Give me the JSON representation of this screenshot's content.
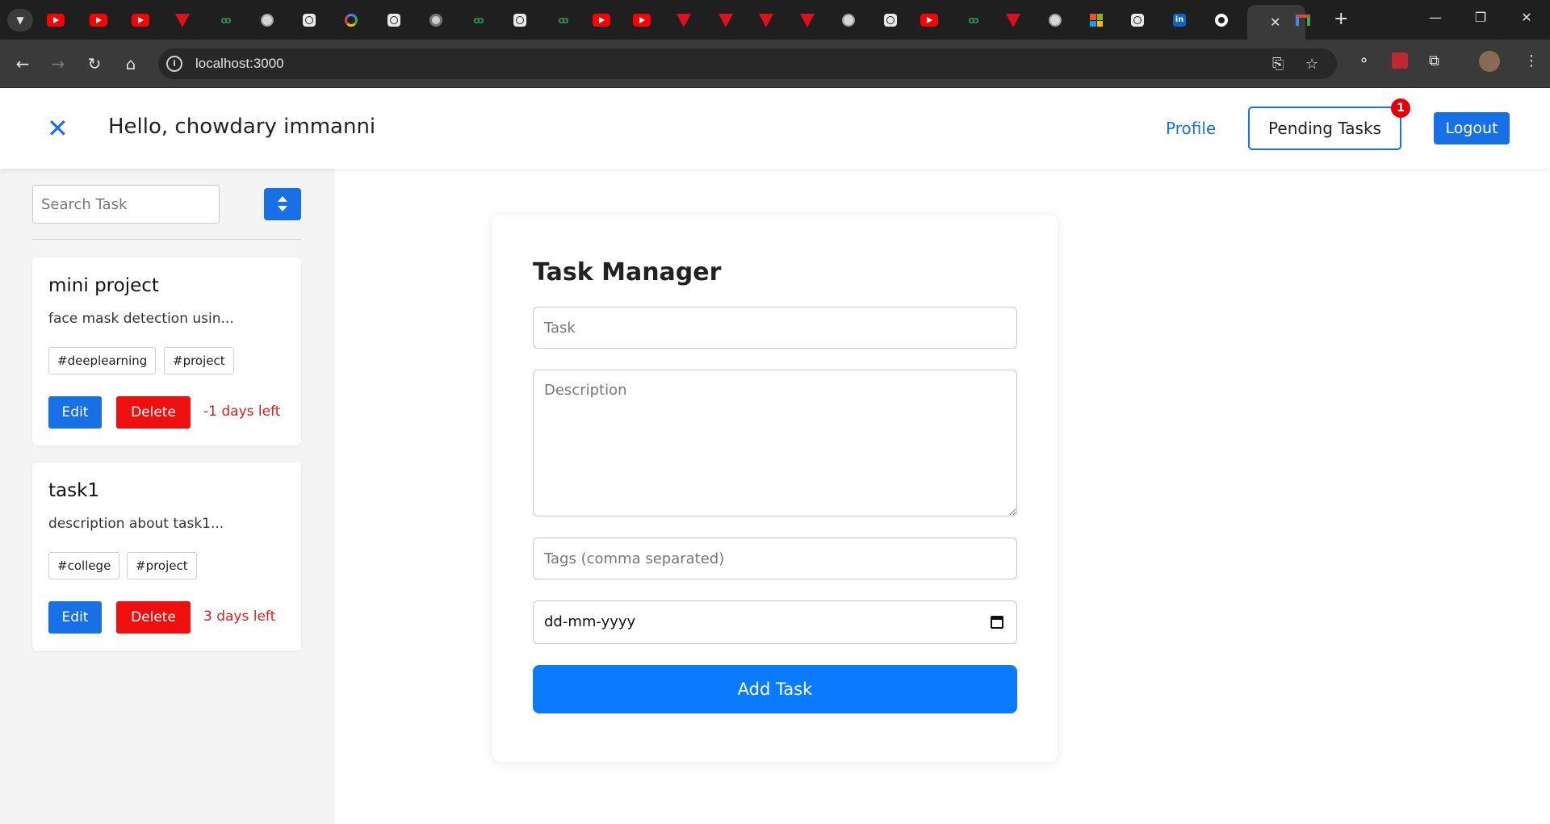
{
  "browser": {
    "url": "localhost:3000",
    "tabs": [
      "youtube-icon",
      "youtube-icon",
      "youtube-icon",
      "tiktok-triangle-icon",
      "gfg-icon",
      "globe-icon",
      "chatgpt-icon",
      "google-icon",
      "chatgpt-icon",
      "chrome-icon",
      "gfg-icon",
      "chatgpt-icon",
      "gfg-icon",
      "youtube-icon",
      "youtube-icon",
      "triangle-icon",
      "triangle-icon",
      "triangle-icon",
      "triangle-icon",
      "globe-icon",
      "chatgpt-icon",
      "youtube-icon",
      "gfg-icon",
      "triangle-icon",
      "globe-icon",
      "microsoft-icon",
      "chatgpt-icon",
      "linkedin-icon",
      "github-icon"
    ],
    "new_tab_label": "+",
    "accent": "#1f1f1f"
  },
  "header": {
    "greeting": "Hello, chowdary immanni",
    "profile_label": "Profile",
    "pending_label": "Pending Tasks",
    "pending_count": "1",
    "logout_label": "Logout",
    "close_symbol": "✕"
  },
  "sidebar": {
    "search_placeholder": "Search Task",
    "cards": [
      {
        "title": "mini project",
        "description": "face mask detection usin...",
        "tags": [
          "#deeplearning",
          "#project"
        ],
        "edit_label": "Edit",
        "delete_label": "Delete",
        "days_left": "-1 days left"
      },
      {
        "title": "task1",
        "description": "description about task1...",
        "tags": [
          "#college",
          "#project"
        ],
        "edit_label": "Edit",
        "delete_label": "Delete",
        "days_left": "3 days left"
      }
    ]
  },
  "form": {
    "title": "Task Manager",
    "task_placeholder": "Task",
    "description_placeholder": "Description",
    "tags_placeholder": "Tags (comma separated)",
    "date_placeholder": "dd-mm-yyyy",
    "submit_label": "Add Task"
  },
  "colors": {
    "primary": "#1770e5",
    "danger": "#f00f0f",
    "add_button": "#0a7bff",
    "sidebar_bg": "#f4f4f4"
  }
}
